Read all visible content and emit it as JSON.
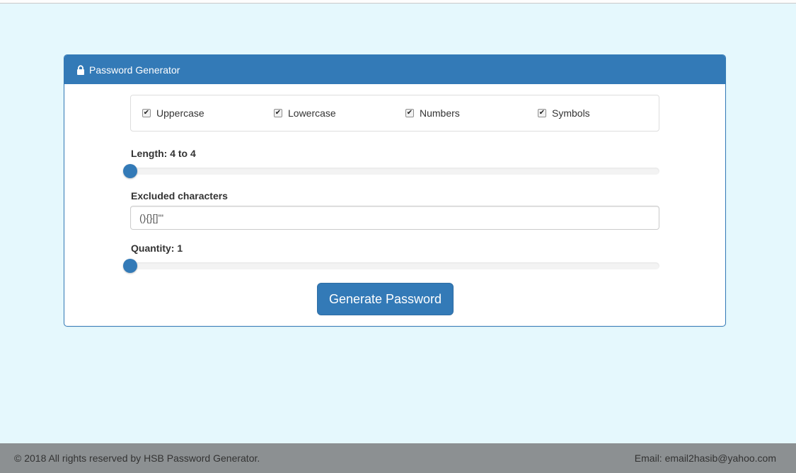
{
  "panel": {
    "title": "Password Generator",
    "icon": "lock-icon",
    "accent_color": "#337ab7"
  },
  "options": [
    {
      "label": "Uppercase",
      "checked": true
    },
    {
      "label": "Lowercase",
      "checked": true
    },
    {
      "label": "Numbers",
      "checked": true
    },
    {
      "label": "Symbols",
      "checked": true
    }
  ],
  "length": {
    "label": "Length: 4 to 4",
    "min_value": 4,
    "max_value": 4,
    "slider_fraction": 0
  },
  "excluded": {
    "label": "Excluded characters",
    "value": "(){}[]'\""
  },
  "quantity": {
    "label": "Quantity: 1",
    "value": 1,
    "slider_fraction": 0
  },
  "actions": {
    "generate_label": "Generate Password"
  },
  "footer": {
    "copyright": "© 2018 All rights reserved by HSB Password Generator.",
    "email": "Email: email2hasib@yahoo.com"
  }
}
